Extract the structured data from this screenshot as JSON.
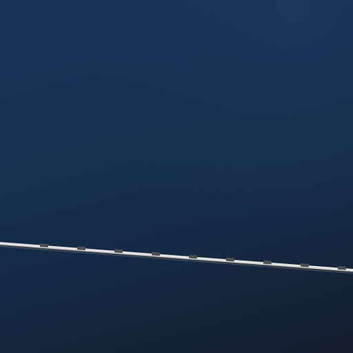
{
  "scene": {
    "colors": {
      "background_top": "#17365a",
      "background_bottom": "#141d2b",
      "rail_base": "#cfcfcf",
      "rail_shadow": "#6f6f6f",
      "segment_mark": "#4f4f4f"
    },
    "icons": {
      "rail": "diagonal-rail"
    }
  }
}
